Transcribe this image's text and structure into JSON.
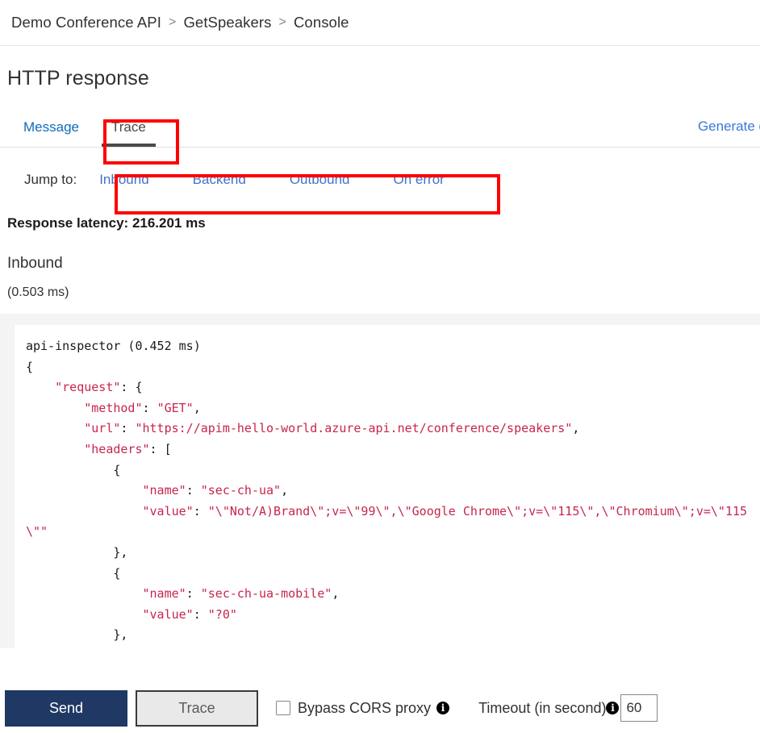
{
  "breadcrumb": {
    "items": [
      "Demo Conference API",
      "GetSpeakers",
      "Console"
    ],
    "separator": ">"
  },
  "page": {
    "title": "HTTP response"
  },
  "tabs": {
    "items": [
      {
        "label": "Message",
        "active": false
      },
      {
        "label": "Trace",
        "active": true
      }
    ],
    "generate_link": "Generate d"
  },
  "jump_to": {
    "label": "Jump to:",
    "links": [
      "Inbound",
      "Backend",
      "Outbound",
      "On error"
    ]
  },
  "trace": {
    "latency": "Response latency: 216.201 ms",
    "section_title": "Inbound",
    "section_duration": "(0.503 ms)"
  },
  "code": {
    "header": "api-inspector (0.452 ms)",
    "line_open_brace": "{",
    "key_request": "\"request\"",
    "key_method": "\"method\"",
    "val_method": "\"GET\"",
    "key_url": "\"url\"",
    "val_url": "\"https://apim-hello-world.azure-api.net/conference/speakers\"",
    "key_headers": "\"headers\"",
    "key_name": "\"name\"",
    "val_name_1": "\"sec-ch-ua\"",
    "key_value": "\"value\"",
    "val_value_1": "\"\\\"Not/A)Brand\\\";v=\\\"99\\\",\\\"Google Chrome\\\";v=\\\"115\\\",\\\"Chromium\\\";v=\\\"115\\\"\"",
    "val_name_2": "\"sec-ch-ua-mobile\"",
    "val_value_2": "\"?0\""
  },
  "toolbar": {
    "send_label": "Send",
    "trace_label": "Trace",
    "cors_label": "Bypass CORS proxy",
    "timeout_label": "Timeout (in second)",
    "timeout_value": "60",
    "info_glyph": "i"
  },
  "colors": {
    "accent_link": "#4472c4",
    "tab_link": "#0f6cbd",
    "send_button": "#1f3864",
    "annotation": "#ff0000",
    "code_string": "#c7254e"
  }
}
